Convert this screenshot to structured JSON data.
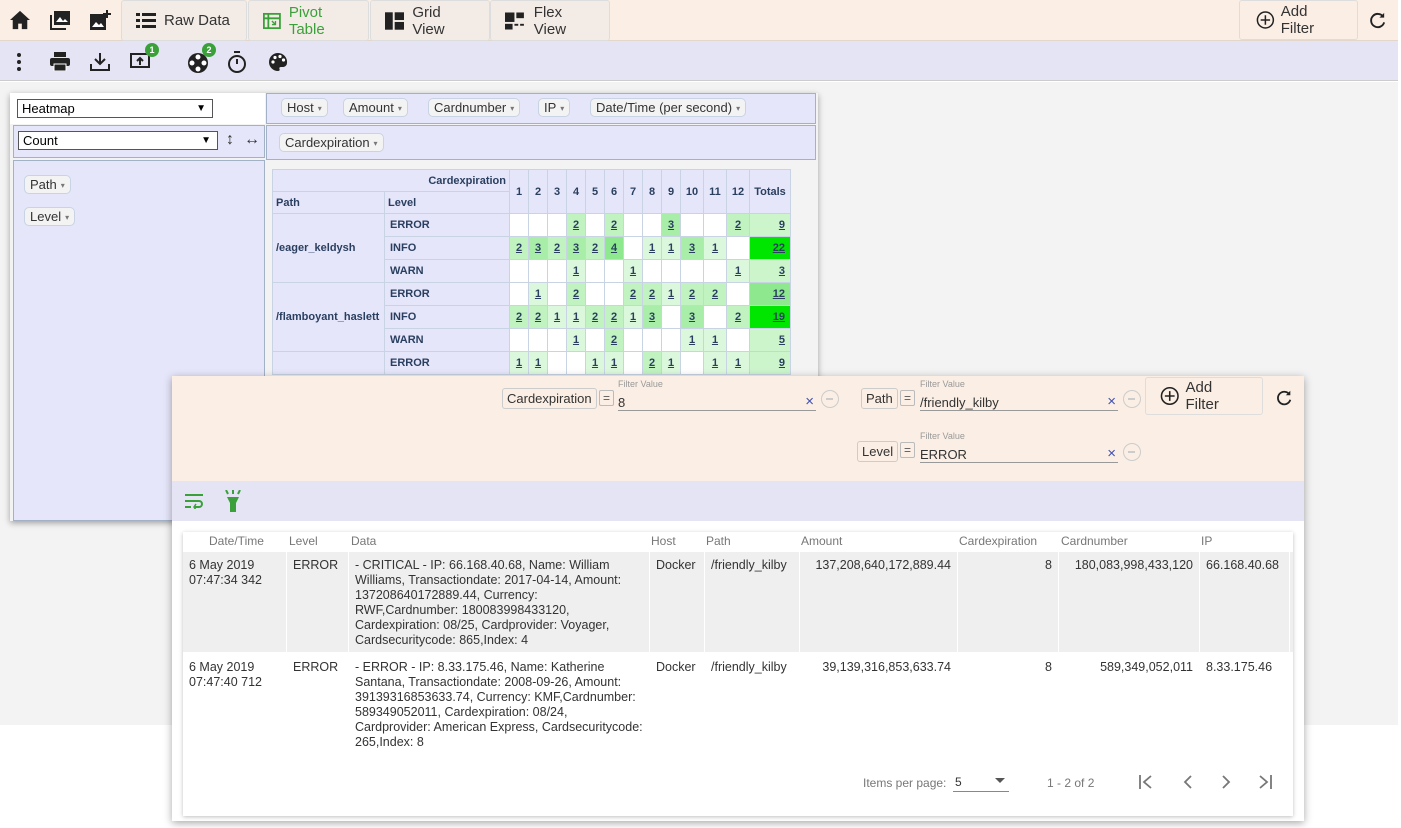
{
  "toolbar": {
    "views": [
      "Raw Data",
      "Pivot Table",
      "Grid View",
      "Flex View"
    ],
    "add_filter": "Add Filter",
    "badges": [
      "1",
      "2"
    ]
  },
  "pivot": {
    "renderer": "Heatmap",
    "aggregator": "Count",
    "col_attrs": [
      "Host",
      "Amount",
      "Cardnumber",
      "IP",
      "Date/Time (per second)"
    ],
    "col_field": "Cardexpiration",
    "row_attrs": [
      "Path",
      "Level"
    ],
    "header": {
      "corner_label": "Cardexpiration",
      "row_h1": "Path",
      "row_h2": "Level",
      "cols": [
        "1",
        "2",
        "3",
        "4",
        "5",
        "6",
        "7",
        "8",
        "9",
        "10",
        "11",
        "12"
      ],
      "totals": "Totals"
    },
    "rows": [
      {
        "path": "/eager_keldysh",
        "level": "ERROR",
        "cells": [
          "",
          "",
          "",
          "2",
          "",
          "2",
          "",
          "",
          "3",
          "",
          "",
          "2"
        ],
        "total": "9"
      },
      {
        "path": "",
        "level": "INFO",
        "cells": [
          "2",
          "3",
          "2",
          "3",
          "2",
          "4",
          "",
          "1",
          "1",
          "3",
          "1",
          ""
        ],
        "total": "22"
      },
      {
        "path": "",
        "level": "WARN",
        "cells": [
          "",
          "",
          "",
          "1",
          "",
          "",
          "1",
          "",
          "",
          "",
          "",
          "1"
        ],
        "total": "3"
      },
      {
        "path": "/flamboyant_haslett",
        "level": "ERROR",
        "cells": [
          "",
          "1",
          "",
          "2",
          "",
          "",
          "2",
          "2",
          "1",
          "2",
          "2",
          ""
        ],
        "total": "12"
      },
      {
        "path": "",
        "level": "INFO",
        "cells": [
          "2",
          "2",
          "1",
          "1",
          "2",
          "2",
          "1",
          "3",
          "",
          "3",
          "",
          "2"
        ],
        "total": "19"
      },
      {
        "path": "",
        "level": "WARN",
        "cells": [
          "",
          "",
          "",
          "1",
          "",
          "2",
          "",
          "",
          "",
          "1",
          "1",
          ""
        ],
        "total": "5"
      },
      {
        "path": "",
        "level": "ERROR",
        "cells": [
          "1",
          "1",
          "",
          "",
          "1",
          "1",
          "",
          "2",
          "1",
          "",
          "1",
          "1"
        ],
        "total": "9"
      }
    ]
  },
  "filters": [
    {
      "field": "Cardexpiration",
      "op": "=",
      "label": "Filter Value",
      "value": "8"
    },
    {
      "field": "Path",
      "op": "=",
      "label": "Filter Value",
      "value": "/friendly_kilby"
    },
    {
      "field": "Level",
      "op": "=",
      "label": "Filter Value",
      "value": "ERROR"
    }
  ],
  "filter_add": "Add Filter",
  "grid": {
    "headers": [
      "Date/Time",
      "Level",
      "Data",
      "Host",
      "Path",
      "Amount",
      "Cardexpiration",
      "Cardnumber",
      "IP"
    ],
    "rows": [
      {
        "datetime": "6 May 2019 07:47:34 342",
        "level": "ERROR",
        "data": "- CRITICAL - IP: 66.168.40.68, Name: William Williams, Transactiondate: 2017-04-14, Amount: 137208640172889.44, Currency: RWF,Cardnumber: 180083998433120, Cardexpiration: 08/25, Cardprovider: Voyager, Cardsecuritycode: 865,Index: 4",
        "host": "Docker",
        "path": "/friendly_kilby",
        "amount": "137,208,640,172,889.44",
        "cardexp": "8",
        "cardnum": "180,083,998,433,120",
        "ip": "66.168.40.68"
      },
      {
        "datetime": "6 May 2019 07:47:40 712",
        "level": "ERROR",
        "data": "- ERROR - IP: 8.33.175.46, Name: Katherine Santana, Transactiondate: 2008-09-26, Amount: 39139316853633.74, Currency: KMF,Cardnumber: 589349052011, Cardexpiration: 08/24, Cardprovider: American Express, Cardsecuritycode: 265,Index: 8",
        "host": "Docker",
        "path": "/friendly_kilby",
        "amount": "39,139,316,853,633.74",
        "cardexp": "8",
        "cardnum": "589,349,052,011",
        "ip": "8.33.175.46"
      }
    ]
  },
  "paginator": {
    "items_label": "Items per page:",
    "page_size": "5",
    "range": "1 - 2 of 2"
  },
  "colors": {
    "heat_low": "#ccf5cc",
    "heat_mid": "#8ee88e",
    "heat_high": "#00e600",
    "accent": "#3aa13a"
  }
}
